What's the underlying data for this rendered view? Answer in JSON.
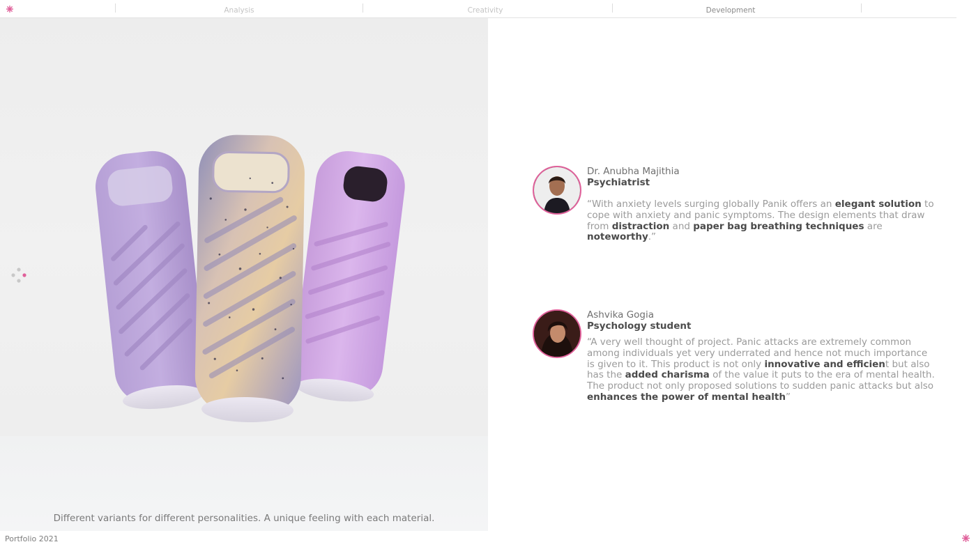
{
  "colors": {
    "accent": "#e0609a",
    "nav_active": "#8a8a8a",
    "nav_inactive": "#c4c4c4",
    "heading": "#4d4d4d",
    "body_text": "#9a9a9a"
  },
  "header": {
    "mark_icon": "pink-asterisk-icon",
    "nav": [
      {
        "label": "Analysis",
        "active": false
      },
      {
        "label": "Creativity",
        "active": false
      },
      {
        "label": "Development",
        "active": true
      }
    ]
  },
  "image_panel": {
    "caption": "Different variants for different personalities. A unique feeling with each material.",
    "loader_icon": "dots-loader-icon"
  },
  "testimonials": [
    {
      "name": "Dr. Anubha Majithia",
      "role": "Psychiatrist",
      "quote": [
        {
          "text": "“With anxiety levels surging globally Panik offers an ",
          "bold": false
        },
        {
          "text": "elegant solution",
          "bold": true
        },
        {
          "text": " to cope with anxiety and panic symptoms. The design elements that draw from ",
          "bold": false
        },
        {
          "text": "distraction",
          "bold": true
        },
        {
          "text": " and ",
          "bold": false
        },
        {
          "text": "paper bag breathing techniques",
          "bold": true
        },
        {
          "text": " are ",
          "bold": false
        },
        {
          "text": "noteworthy",
          "bold": true
        },
        {
          "text": ".”",
          "bold": false
        }
      ]
    },
    {
      "name": "Ashvika Gogia",
      "role": "Psychology student",
      "quote": [
        {
          "text": "“A very well thought of project. Panic attacks are extremely common among individuals yet very underrated and hence not much importance is given to it. This product is not only ",
          "bold": false
        },
        {
          "text": "innovative and efficien",
          "bold": true
        },
        {
          "text": "t but also has the ",
          "bold": false
        },
        {
          "text": "added charisma",
          "bold": true
        },
        {
          "text": " of the value it puts to the era of mental health. The product not only proposed solutions to sudden panic attacks but also ",
          "bold": false
        },
        {
          "text": "enhances the power of mental health",
          "bold": true
        },
        {
          "text": "”",
          "bold": false
        }
      ]
    }
  ],
  "footer": {
    "label": "Portfolio 2021",
    "mark_icon": "pink-asterisk-icon"
  }
}
